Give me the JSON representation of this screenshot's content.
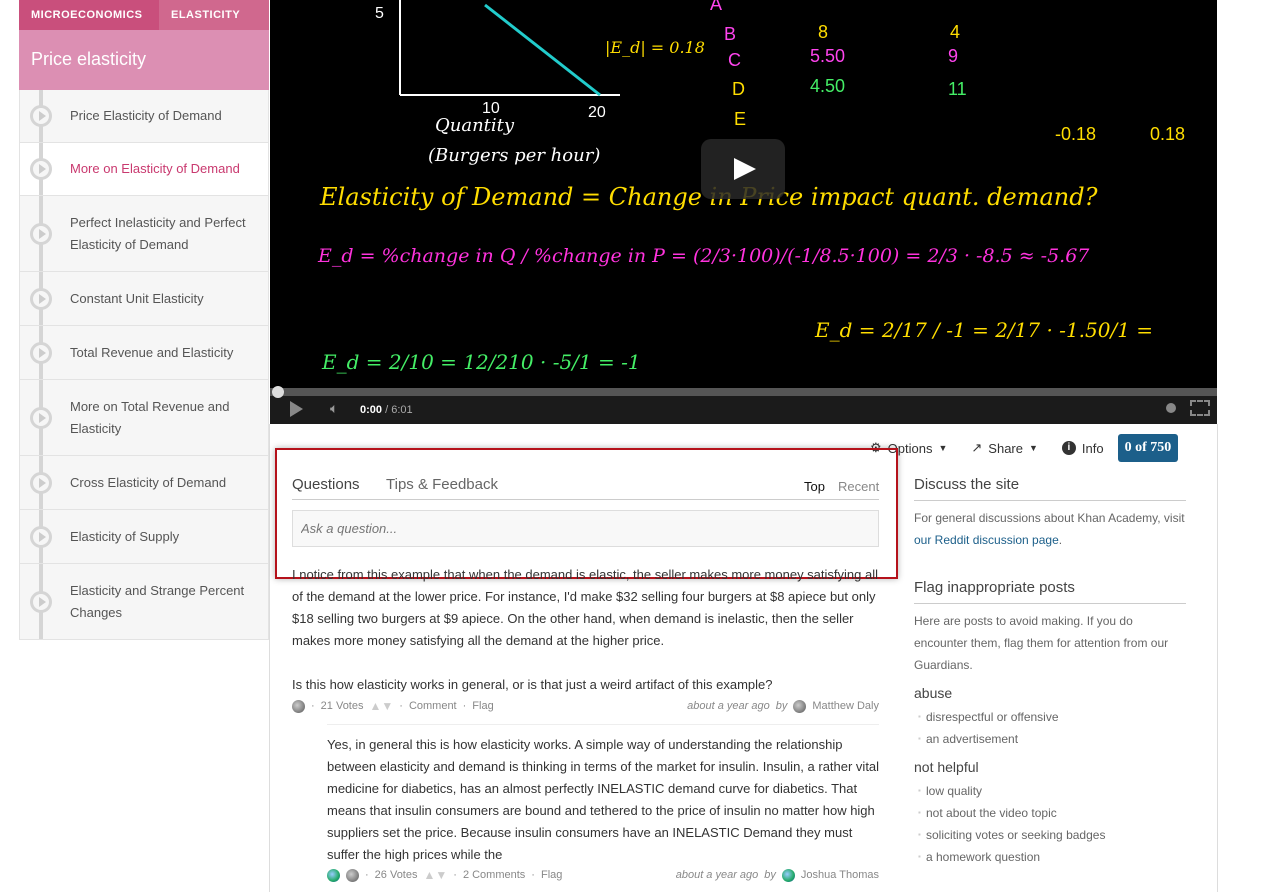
{
  "breadcrumb": {
    "subject": "MICROECONOMICS",
    "topic": "ELASTICITY"
  },
  "tutorial_title": "Price elasticity",
  "playlist": [
    {
      "label": "Price Elasticity of Demand",
      "active": false
    },
    {
      "label": "More on Elasticity of Demand",
      "active": true
    },
    {
      "label": "Perfect Inelasticity and Perfect Elasticity of Demand",
      "active": false
    },
    {
      "label": "Constant Unit Elasticity",
      "active": false
    },
    {
      "label": "Total Revenue and Elasticity",
      "active": false
    },
    {
      "label": "More on Total Revenue and Elasticity",
      "active": false
    },
    {
      "label": "Cross Elasticity of Demand",
      "active": false
    },
    {
      "label": "Elasticity of Supply",
      "active": false
    },
    {
      "label": "Elasticity and Strange Percent Changes",
      "active": false
    }
  ],
  "video": {
    "current_time": "0:00",
    "duration": "/ 6:01",
    "progress": 0,
    "board": {
      "l1": "Quantity",
      "l2": "(Burgers per hour)",
      "l3": "Elasticity of Demand = Change in Price impact quant. demand?",
      "l4": "|E_d| = 0.18",
      "l5": "E_d = %change in Q / %change in P = (2/3·100)/(-1/8.5·100) = 2/3 · -8.5 ≈ -5.67",
      "l6": "E_d = 2/10 = 12/210 · -5/1 = -1",
      "l7": "E_d = 2/17 / -1 = 2/17 · -1.50/1 ="
    }
  },
  "toolbar": {
    "options": "Options",
    "share": "Share",
    "info": "Info",
    "points": "0 of 750"
  },
  "discussion": {
    "tabs": [
      "Questions",
      "Tips & Feedback"
    ],
    "sort": [
      "Top",
      "Recent"
    ],
    "ask_placeholder": "Ask a question...",
    "question": {
      "text": "I notice from this example that when the demand is elastic, the seller makes more money satisfying all of the demand at the lower price. For instance, I'd make $32 selling four burgers at $8 apiece but only $18 selling two burgers at $9 apiece. On the other hand, when demand is inelastic, then the seller makes more money satisfying all the demand at the higher price.",
      "text2": "Is this how elasticity works in general, or is that just a weird artifact of this example?",
      "votes": "21 Votes",
      "comment": "Comment",
      "flag": "Flag",
      "time": "about a year ago",
      "by": "by",
      "author": "Matthew Daly"
    },
    "answer": {
      "text": "Yes, in general this is how elasticity works. A simple way of understanding the relationship between elasticity and demand is thinking in terms of the market for insulin. Insulin, a rather vital medicine for diabetics, has an almost perfectly INELASTIC demand curve for diabetics. That means that insulin consumers are bound and tethered to the price of insulin no matter how high suppliers set the price. Because insulin consumers have an INELASTIC Demand they must suffer the high prices while the",
      "votes": "26 Votes",
      "comments": "2 Comments",
      "flag": "Flag",
      "time": "about a year ago",
      "by": "by",
      "author": "Joshua Thomas"
    }
  },
  "side": {
    "discuss_title": "Discuss the site",
    "discuss_text": "For general discussions about Khan Academy, visit",
    "discuss_link": "our Reddit discussion page",
    "flag_title": "Flag inappropriate posts",
    "flag_text": "Here are posts to avoid making. If you do encounter them, flag them for attention from our Guardians.",
    "groups": [
      {
        "title": "abuse",
        "items": [
          "disrespectful or offensive",
          "an advertisement"
        ]
      },
      {
        "title": "not helpful",
        "items": [
          "low quality",
          "not about the video topic",
          "soliciting votes or seeking badges",
          "a homework question"
        ]
      }
    ]
  },
  "colors": {
    "highlight": "#b5121b",
    "brand_pink": "#c94f7c",
    "link": "#1c5f8a"
  }
}
